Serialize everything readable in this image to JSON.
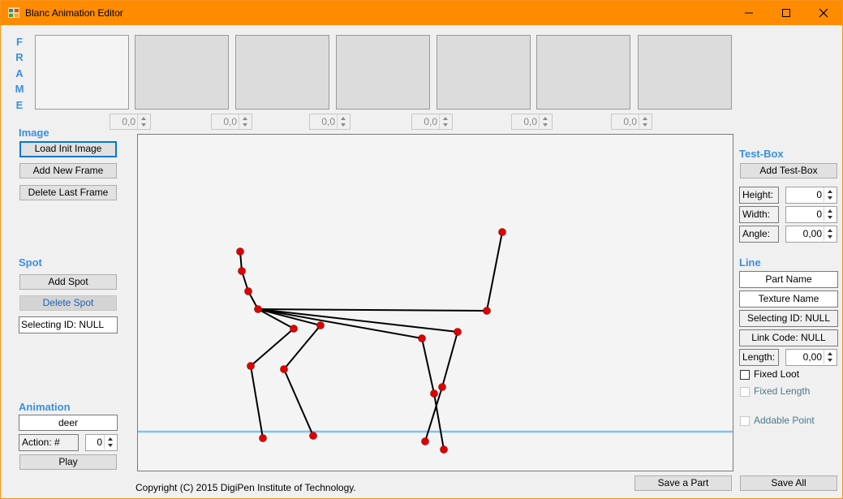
{
  "window": {
    "title": "Blanc Animation Editor"
  },
  "frame": {
    "letters": [
      "F",
      "R",
      "A",
      "M",
      "E"
    ],
    "durations": [
      "0,0",
      "0,0",
      "0,0",
      "0,0",
      "0,0",
      "0,0"
    ]
  },
  "image": {
    "heading": "Image",
    "load_label": "Load Init Image",
    "add_frame_label": "Add New Frame",
    "delete_frame_label": "Delete Last Frame"
  },
  "spot": {
    "heading": "Spot",
    "add_label": "Add Spot",
    "delete_label": "Delete Spot",
    "selecting": "Selecting ID: NULL"
  },
  "animation": {
    "heading": "Animation",
    "name": "deer",
    "action_label": "Action: #",
    "action_value": "0",
    "play_label": "Play"
  },
  "testbox": {
    "heading": "Test-Box",
    "add_label": "Add Test-Box",
    "height_label": "Height:",
    "height_value": "0",
    "width_label": "Width:",
    "width_value": "0",
    "angle_label": "Angle:",
    "angle_value": "0,00"
  },
  "line": {
    "heading": "Line",
    "part_name": "Part Name",
    "texture_name": "Texture Name",
    "selecting": "Selecting ID: NULL",
    "link_code": "Link Code: NULL",
    "length_label": "Length:",
    "length_value": "0,00",
    "fixed_loot": "Fixed Loot",
    "fixed_length": "Fixed Length",
    "addable_point": "Addable Point"
  },
  "buttons": {
    "save_part": "Save a Part",
    "save_all": "Save All"
  },
  "footer": "Copyright (C) 2015 DigiPen Institute of Technology.",
  "colors": {
    "titlebar": "#ff8c00",
    "accent": "#3b8fe0",
    "spot": "#e00000",
    "ground": "#7ec4ec"
  }
}
